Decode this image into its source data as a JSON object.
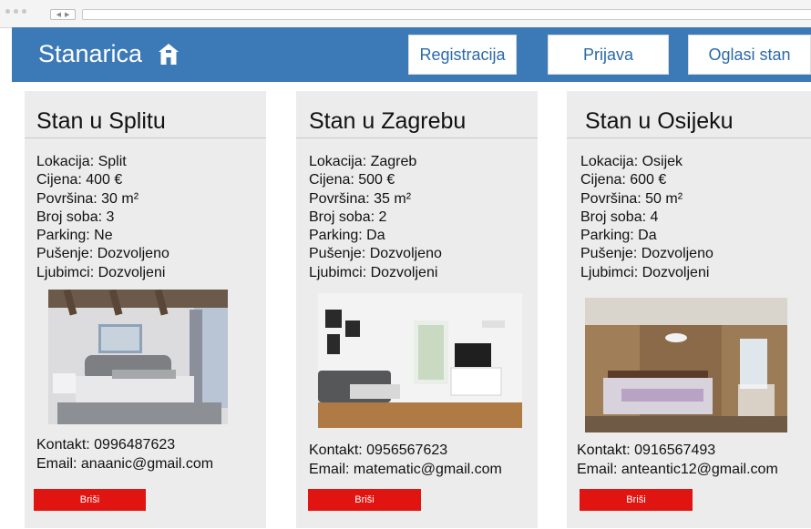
{
  "header": {
    "brand": "Stanarica",
    "nav": {
      "register": "Registracija",
      "login": "Prijava",
      "post_ad": "Oglasi stan"
    }
  },
  "listings": [
    {
      "title": "Stan u Splitu",
      "location": "Lokacija: Split",
      "price": "Cijena: 400 €",
      "area": "Površina: 30 m²",
      "rooms": "Broj soba: 3",
      "parking": "Parking: Ne",
      "smoking": "Pušenje: Dozvoljeno",
      "pets": "Ljubimci: Dozvoljeni",
      "contact": "Kontakt: 0996487623",
      "email": "Email: anaanic@gmail.com",
      "delete_label": "Briši"
    },
    {
      "title": "Stan u Zagrebu",
      "location": "Lokacija: Zagreb",
      "price": "Cijena: 500 €",
      "area": "Površina: 35 m²",
      "rooms": "Broj soba: 2",
      "parking": "Parking: Da",
      "smoking": "Pušenje: Dozvoljeno",
      "pets": "Ljubimci: Dozvoljeni",
      "contact": "Kontakt: 0956567623",
      "email": "Email: matematic@gmail.com",
      "delete_label": "Briši"
    },
    {
      "title": "Stan u Osijeku",
      "location": "Lokacija: Osijek",
      "price": "Cijena: 600 €",
      "area": "Površina: 50 m²",
      "rooms": "Broj soba: 4",
      "parking": "Parking: Da",
      "smoking": "Pušenje: Dozvoljeno",
      "pets": "Ljubimci: Dozvoljeni",
      "contact": "Kontakt: 0916567493",
      "email": "Email: anteantic12@gmail.com",
      "delete_label": "Briši"
    }
  ],
  "colors": {
    "header_bg": "#3b7ab6",
    "card_bg": "#ececec",
    "delete_bg": "#e01410",
    "nav_text": "#2a6aa8"
  },
  "icons": {
    "brand": "home-icon"
  }
}
